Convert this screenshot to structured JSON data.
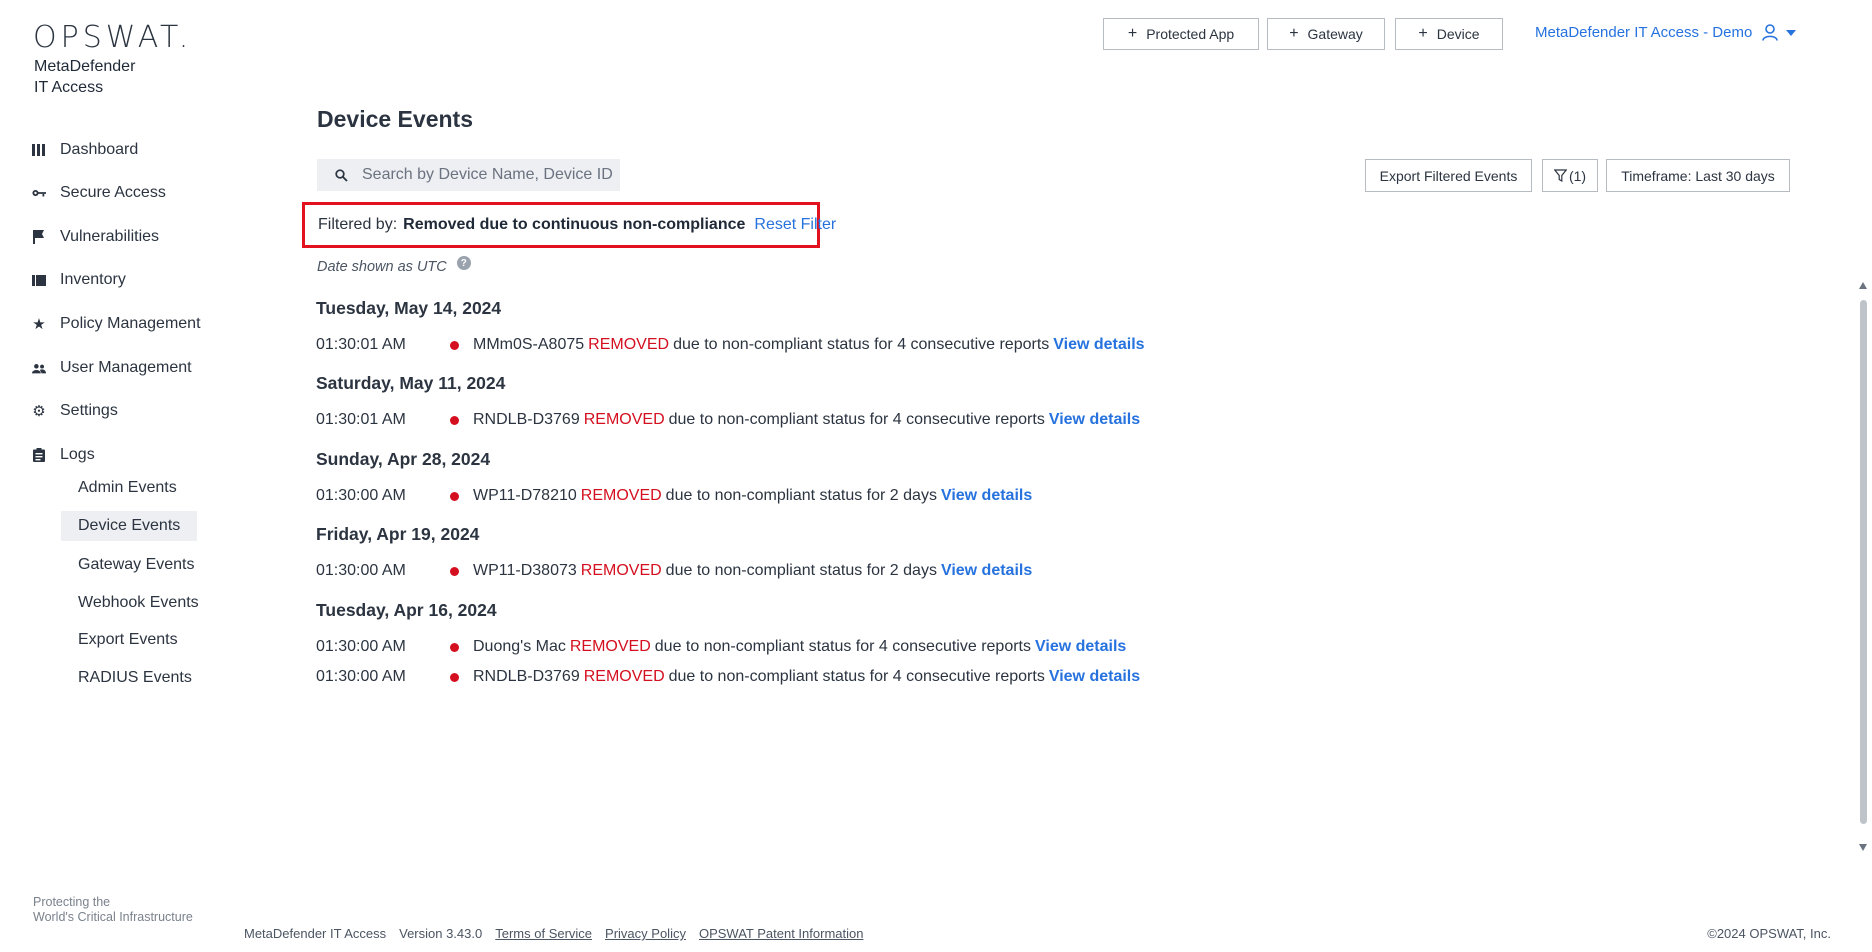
{
  "sidebar": {
    "logo": "OPSWAT.",
    "product_line1": "MetaDefender",
    "product_line2": "IT Access",
    "items": [
      {
        "label": "Dashboard",
        "icon": "dashboard-icon"
      },
      {
        "label": "Secure Access",
        "icon": "key-icon"
      },
      {
        "label": "Vulnerabilities",
        "icon": "flag-icon"
      },
      {
        "label": "Inventory",
        "icon": "inventory-icon"
      },
      {
        "label": "Policy Management",
        "icon": "star-icon"
      },
      {
        "label": "User Management",
        "icon": "users-icon"
      },
      {
        "label": "Settings",
        "icon": "gear-icon"
      },
      {
        "label": "Logs",
        "icon": "clipboard-icon"
      }
    ],
    "logs_sub": [
      {
        "label": "Admin Events",
        "active": false
      },
      {
        "label": "Device Events",
        "active": true
      },
      {
        "label": "Gateway Events",
        "active": false
      },
      {
        "label": "Webhook Events",
        "active": false
      },
      {
        "label": "Export Events",
        "active": false
      },
      {
        "label": "RADIUS Events",
        "active": false
      }
    ],
    "tagline_line1": "Protecting the",
    "tagline_line2": "World's Critical Infrastructure"
  },
  "topbar": {
    "protected_app": "Protected App",
    "gateway": "Gateway",
    "device": "Device",
    "account": "MetaDefender IT Access - Demo"
  },
  "main": {
    "title": "Device Events",
    "search_placeholder": "Search by Device Name, Device ID",
    "export_btn": "Export Filtered Events",
    "filter_count": "(1)",
    "timeframe_btn": "Timeframe: Last 30 days",
    "filter_label": "Filtered by:",
    "filter_value": "Removed due to continuous non-compliance",
    "reset_filter": "Reset Filter",
    "utc_note": "Date shown as UTC",
    "groups": [
      {
        "date": "Tuesday, May 14, 2024",
        "events": [
          {
            "time": "01:30:01 AM",
            "device": "MMm0S-A8075",
            "status": "REMOVED",
            "text": "due to non-compliant status for 4 consecutive reports",
            "link": "View details"
          }
        ]
      },
      {
        "date": "Saturday, May 11, 2024",
        "events": [
          {
            "time": "01:30:01 AM",
            "device": "RNDLB-D3769",
            "status": "REMOVED",
            "text": "due to non-compliant status for 4 consecutive reports",
            "link": "View details"
          }
        ]
      },
      {
        "date": "Sunday, Apr 28, 2024",
        "events": [
          {
            "time": "01:30:00 AM",
            "device": "WP11-D78210",
            "status": "REMOVED",
            "text": "due to non-compliant status for 2 days",
            "link": "View details"
          }
        ]
      },
      {
        "date": "Friday, Apr 19, 2024",
        "events": [
          {
            "time": "01:30:00 AM",
            "device": "WP11-D38073",
            "status": "REMOVED",
            "text": "due to non-compliant status for 2 days",
            "link": "View details"
          }
        ]
      },
      {
        "date": "Tuesday, Apr 16, 2024",
        "events": [
          {
            "time": "01:30:00 AM",
            "device": "Duong's Mac",
            "status": "REMOVED",
            "text": "due to non-compliant status for 4 consecutive reports",
            "link": "View details"
          },
          {
            "time": "01:30:00 AM",
            "device": "RNDLB-D3769",
            "status": "REMOVED",
            "text": "due to non-compliant status for 4 consecutive reports",
            "link": "View details"
          }
        ]
      }
    ]
  },
  "footer": {
    "product": "MetaDefender IT Access",
    "version": "Version 3.43.0",
    "terms": "Terms of Service",
    "privacy": "Privacy Policy",
    "patent": "OPSWAT Patent Information",
    "copyright": "©2024 OPSWAT, Inc."
  },
  "colors": {
    "accent": "#2672de",
    "removed": "#d40f1f",
    "highlight_border": "#e3111d"
  }
}
